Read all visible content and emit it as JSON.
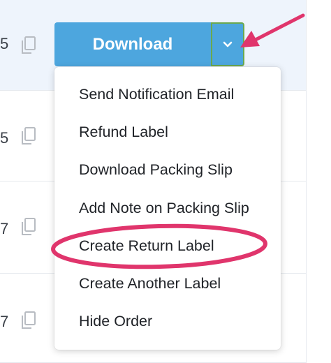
{
  "rows": [
    {
      "digit": "5"
    },
    {
      "digit": "5"
    },
    {
      "digit": "7"
    },
    {
      "digit": "7"
    }
  ],
  "download_button": {
    "label": "Download"
  },
  "dropdown_icon": "chevron-down-icon",
  "copy_icon": "copy-icon",
  "menu": {
    "items": [
      {
        "label": "Send Notification Email"
      },
      {
        "label": "Refund Label"
      },
      {
        "label": "Download Packing Slip"
      },
      {
        "label": "Add Note on Packing Slip"
      },
      {
        "label": "Create Return Label",
        "highlighted": true
      },
      {
        "label": "Create Another Label"
      },
      {
        "label": "Hide Order"
      }
    ]
  },
  "colors": {
    "button": "#4da6de",
    "caret_border": "#6aa84f",
    "annotation": "#e0356c",
    "row_highlight": "#eef4fc"
  }
}
